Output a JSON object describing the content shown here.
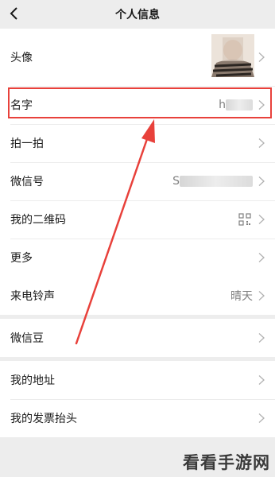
{
  "navbar": {
    "title": "个人信息"
  },
  "sections": {
    "profile": {
      "avatar_label": "头像",
      "name_label": "名字",
      "name_value": "h",
      "pat_label": "拍一拍",
      "wechat_id_label": "微信号",
      "wechat_id_value": "S",
      "qr_label": "我的二维码",
      "more_label": "更多"
    },
    "ringtone": {
      "label": "来电铃声",
      "value": "晴天"
    },
    "beans": {
      "label": "微信豆"
    },
    "address": {
      "address_label": "我的地址",
      "invoice_label": "我的发票抬头"
    }
  },
  "watermark": "看看手游网",
  "colors": {
    "annotation": "#e8413b",
    "background": "#ededed"
  }
}
